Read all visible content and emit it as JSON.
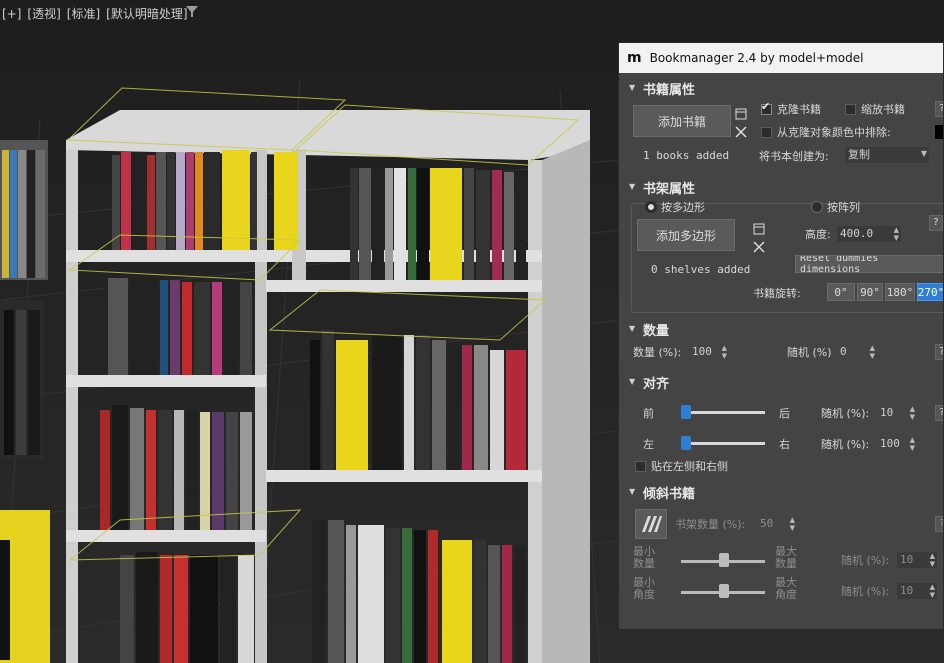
{
  "viewport": {
    "labels": [
      "[+]",
      "[透视]",
      "[标准]",
      "[默认明暗处理]"
    ]
  },
  "panel": {
    "logo": "m",
    "title": "Bookmanager 2.4 by model+model",
    "books": {
      "header": "书籍属性",
      "add_button": "添加书籍",
      "status": "1 books added",
      "clone_books": "克隆书籍",
      "scale_books": "缩放书籍",
      "exclude_color": "从克隆对象颜色中排除:",
      "create_as_label": "将书本创建为:",
      "create_as_value": "复制",
      "help": "?"
    },
    "shelf": {
      "header": "书架属性",
      "by_polygon": "按多边形",
      "by_array": "按阵列",
      "add_button": "添加多边形",
      "status": "0 shelves added",
      "height_label": "高度:",
      "height_value": "400.0",
      "reset_button": "Reset dummies dimensions",
      "rotation_label": "书籍旋转:",
      "rotations": [
        "0°",
        "90°",
        "180°",
        "270°"
      ],
      "help": "?"
    },
    "quantity": {
      "header": "数量",
      "count_label": "数量 (%):",
      "count_value": "100",
      "random_label": "随机 (%)",
      "random_value": "0",
      "help": "?"
    },
    "align": {
      "header": "对齐",
      "front": "前",
      "back": "后",
      "left": "左",
      "right": "右",
      "random1_label": "随机 (%):",
      "random1_value": "10",
      "random2_label": "随机 (%):",
      "random2_value": "100",
      "stick_sides": "贴在左侧和右侧",
      "help": "?"
    },
    "tilt": {
      "header": "倾斜书籍",
      "shelf_count_label": "书架数量 (%):",
      "shelf_count_value": "50",
      "min_count": "最小数量",
      "max_count": "最大数量",
      "min_angle": "最小角度",
      "max_angle": "最大角度",
      "random1_label": "随机 (%):",
      "random1_value": "10",
      "random2_label": "随机 (%):",
      "random2_value": "10",
      "help": "?"
    },
    "colors": {
      "accent": "#2d7fd6",
      "panel_bg": "#444444",
      "titlebar_bg": "#f2f2f2"
    }
  }
}
